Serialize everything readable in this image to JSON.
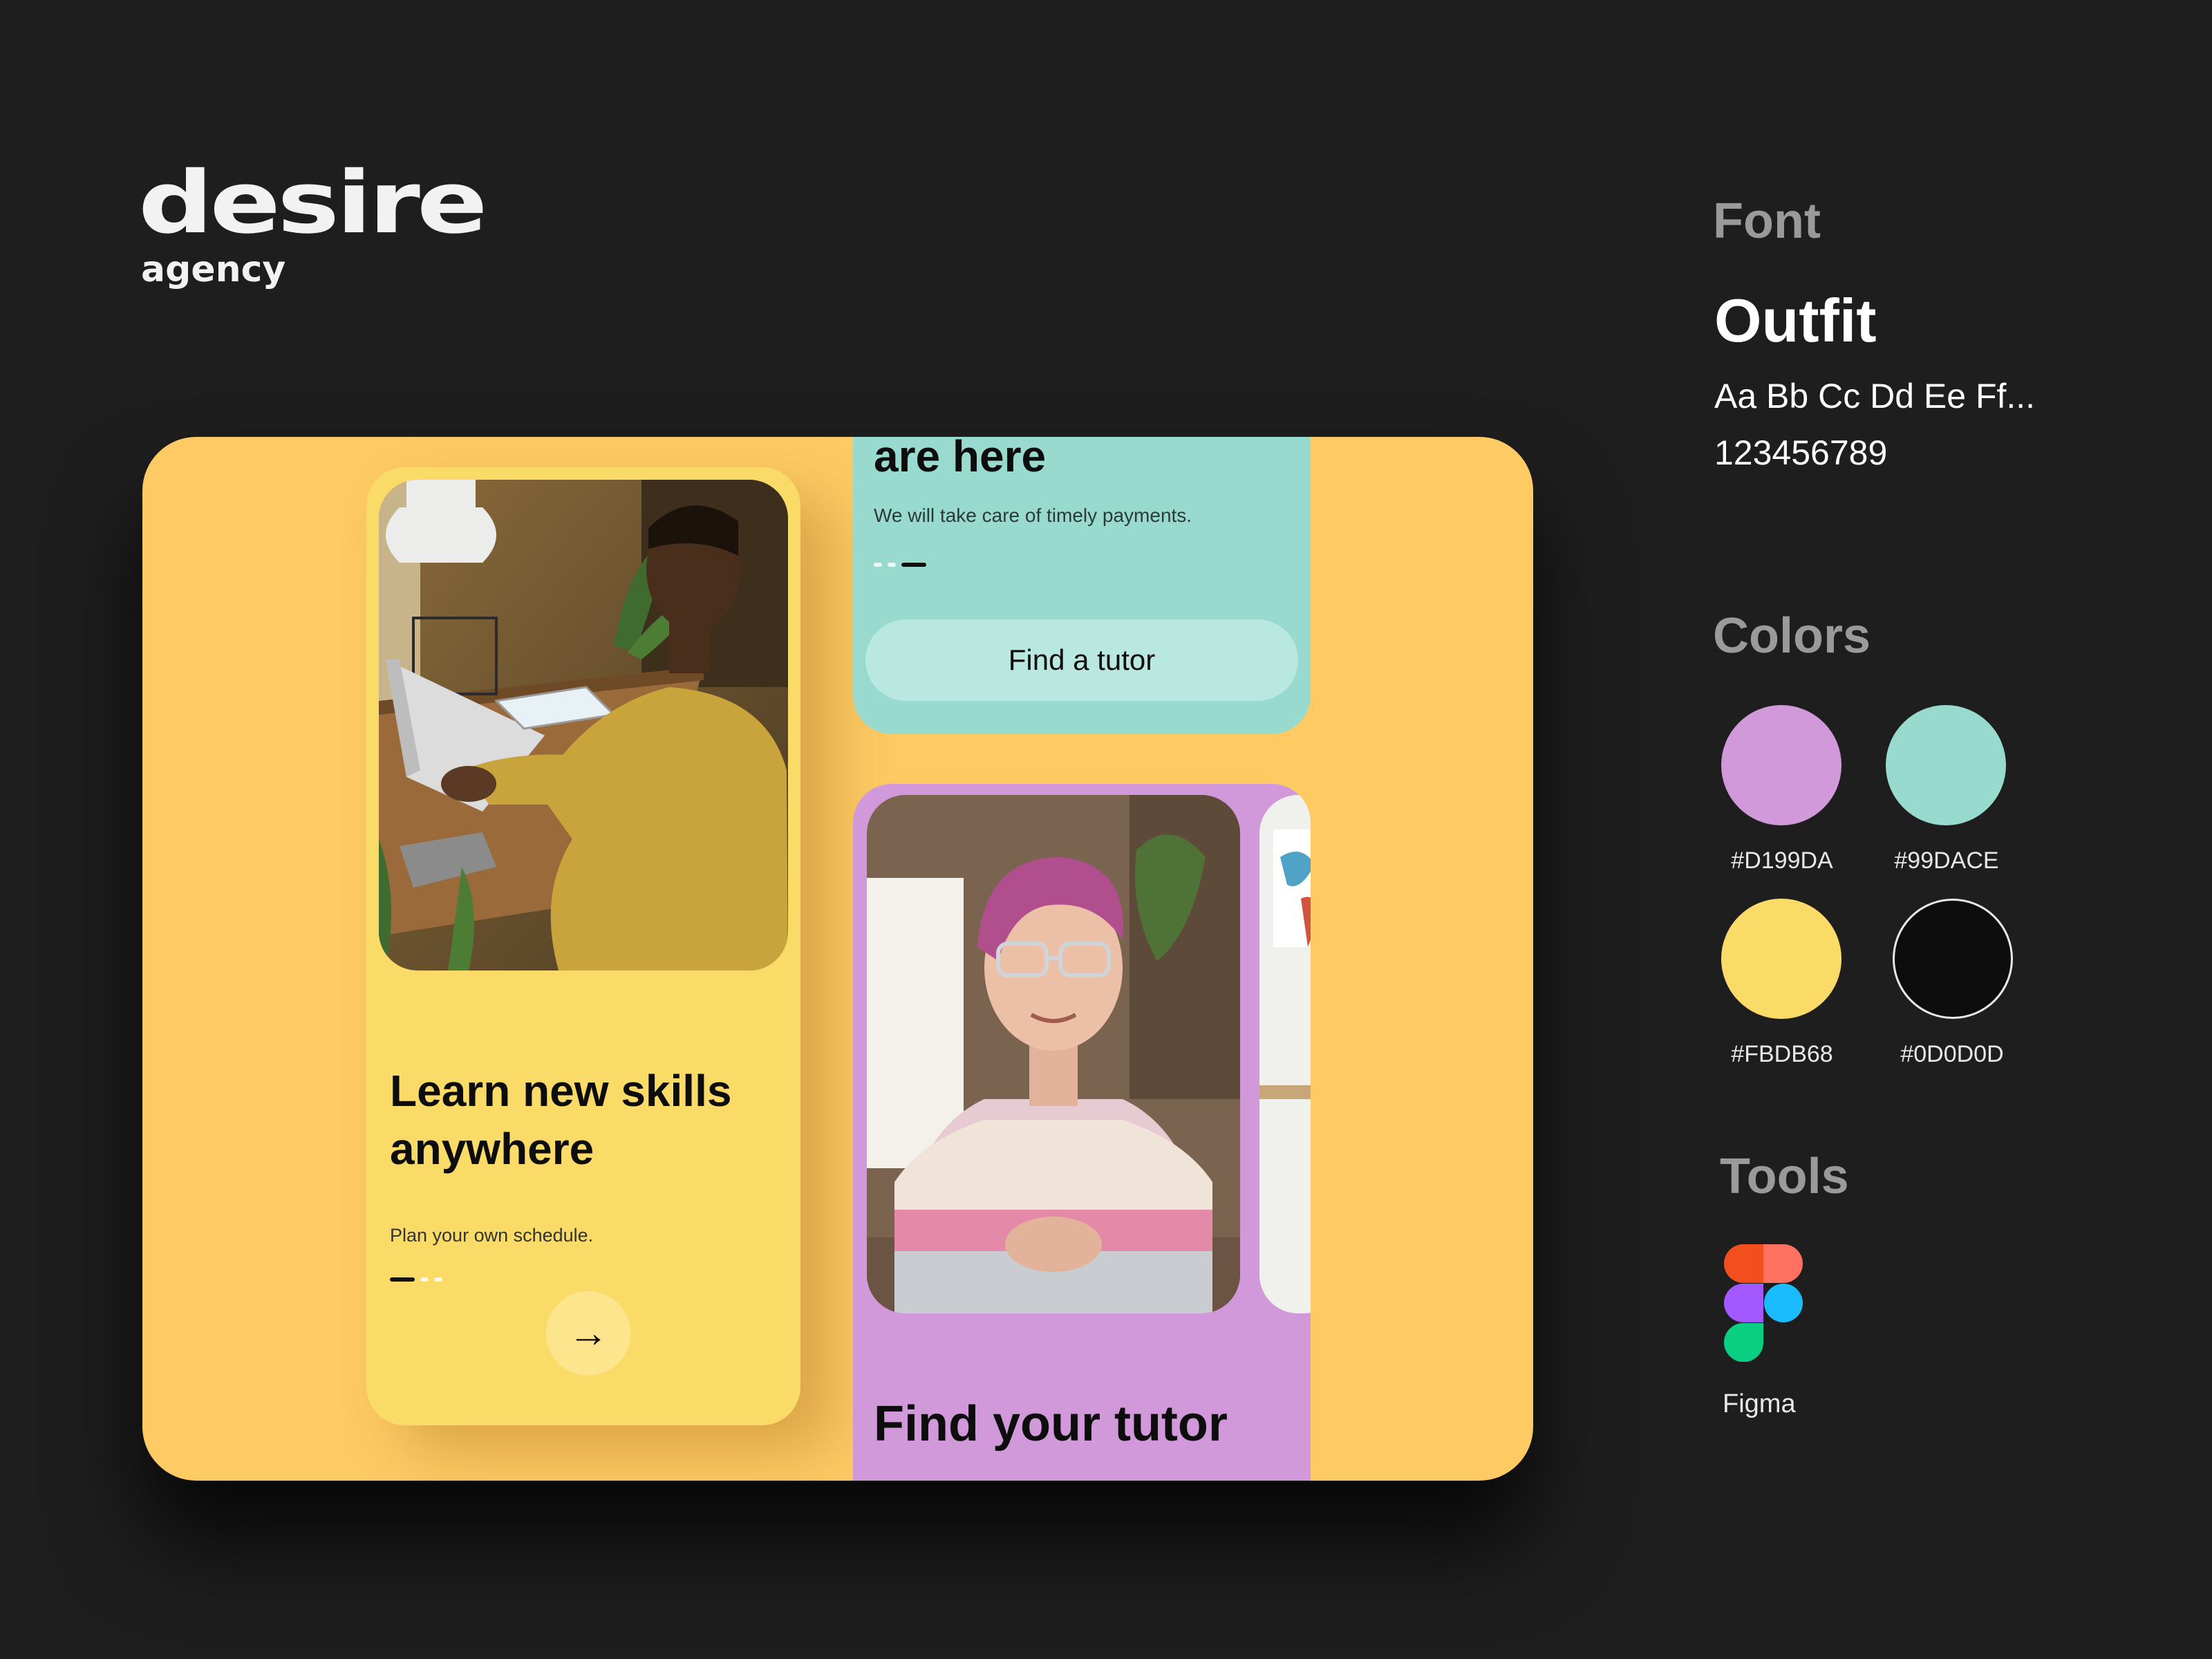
{
  "brand": {
    "name": "desire",
    "sub": "agency"
  },
  "showcase": {
    "card_yellow": {
      "heading": "Learn new skills anywhere",
      "subtext": "Plan your own schedule.",
      "arrow_glyph": "→",
      "active_dot": 1
    },
    "card_teal": {
      "heading": "are here",
      "subtext": "We will take care of timely payments.",
      "button": "Find a tutor",
      "active_dot": 3
    },
    "card_purple": {
      "heading": "Find your tutor"
    }
  },
  "font_section": {
    "title": "Font",
    "font_name": "Outfit",
    "sample": "Aa Bb Cc Dd Ee Ff...",
    "digits": "123456789"
  },
  "colors_section": {
    "title": "Colors",
    "swatches": [
      {
        "hex": "#D199DA",
        "color": "#d199da"
      },
      {
        "hex": "#99DACE",
        "color": "#99dace"
      },
      {
        "hex": "#FBDB68",
        "color": "#fbdb68"
      },
      {
        "hex": "#0D0D0D",
        "color": "#0d0d0d"
      }
    ]
  },
  "tools_section": {
    "title": "Tools",
    "tools": [
      {
        "name": "Figma",
        "icon": "figma-icon"
      }
    ]
  }
}
